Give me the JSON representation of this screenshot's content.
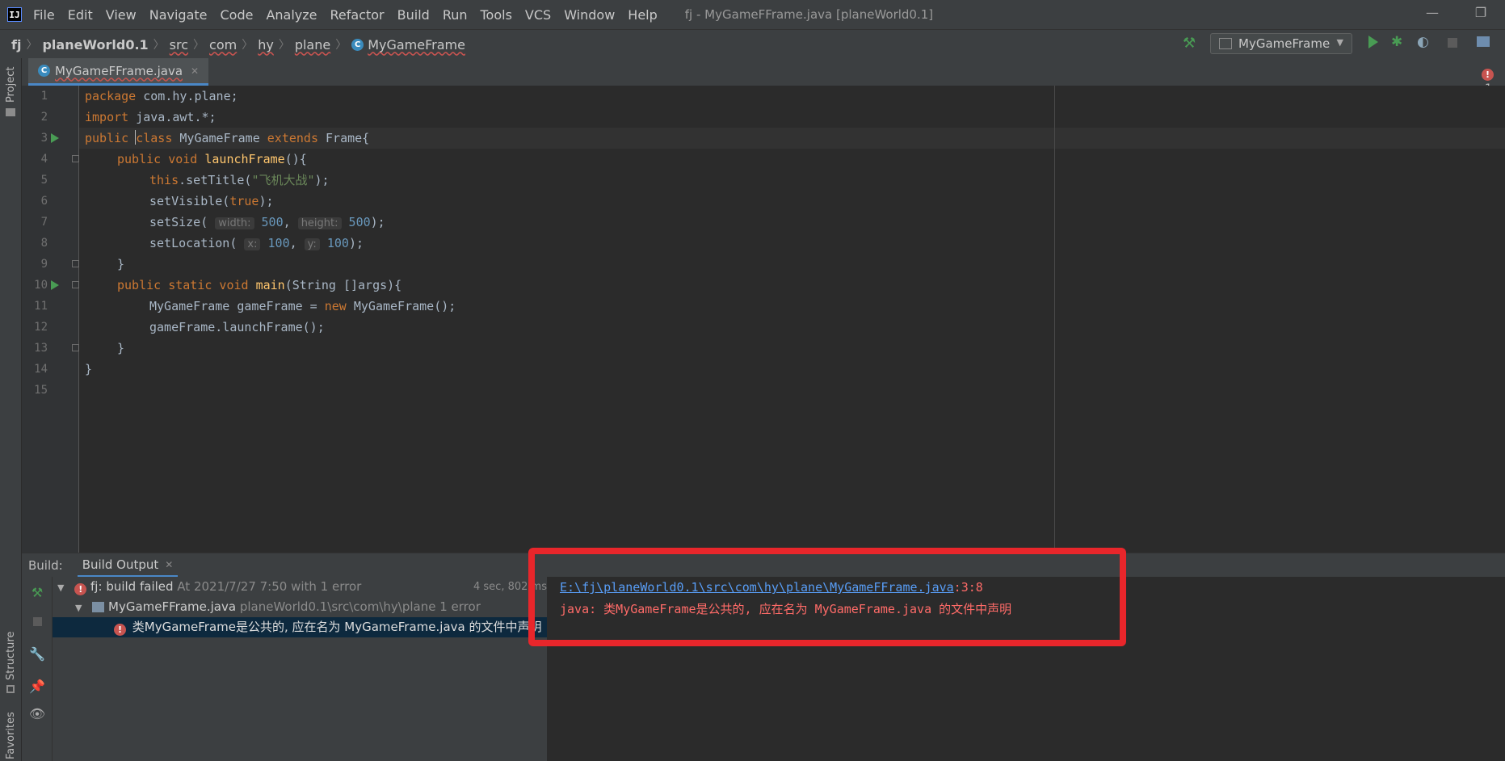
{
  "window": {
    "app_icon": "IJ",
    "title": "fj - MyGameFFrame.java [planeWorld0.1]",
    "minimize": "—",
    "restore": "❐"
  },
  "menu": [
    "File",
    "Edit",
    "View",
    "Navigate",
    "Code",
    "Analyze",
    "Refactor",
    "Build",
    "Run",
    "Tools",
    "VCS",
    "Window",
    "Help"
  ],
  "breadcrumb": [
    "fj",
    "planeWorld0.1",
    "src",
    "com",
    "hy",
    "plane",
    "MyGameFrame"
  ],
  "run_config": {
    "label": "MyGameFrame"
  },
  "left_strip": {
    "project": "Project",
    "structure": "Structure",
    "favorites": "Favorites"
  },
  "editor_tab": {
    "label": "MyGameFFrame.java",
    "close": "✕"
  },
  "error_stripe": {
    "count": "1"
  },
  "code_lines": [
    "1",
    "2",
    "3",
    "4",
    "5",
    "6",
    "7",
    "8",
    "9",
    "10",
    "11",
    "12",
    "13",
    "14",
    "15"
  ],
  "code": {
    "l1": [
      "package",
      " com.hy.plane;"
    ],
    "l2": [
      "import",
      " java.awt.*;"
    ],
    "l3": [
      "public",
      " ",
      "class",
      " MyGameFrame ",
      "extends",
      " Frame{"
    ],
    "l4": [
      "public void ",
      "launchFrame",
      "(){"
    ],
    "l5": [
      "this",
      ".setTitle(",
      "\"飞机大战\"",
      ");"
    ],
    "l6": [
      "setVisible(",
      "true",
      ");"
    ],
    "l7": [
      "setSize( ",
      "width:",
      " 500",
      ", ",
      "height:",
      " 500",
      ");"
    ],
    "l8": [
      "setLocation( ",
      "x:",
      " 100",
      ", ",
      "y:",
      " 100",
      ");"
    ],
    "l9": "}",
    "l10": [
      "public static void ",
      "main",
      "(String []args){"
    ],
    "l11": [
      "MyGameFrame gameFrame = ",
      "new",
      " MyGameFrame();"
    ],
    "l12": "gameFrame.launchFrame();",
    "l13": "}",
    "l14": "}"
  },
  "build": {
    "label": "Build:",
    "tab": "Build Output",
    "tab_close": "✕",
    "tree": {
      "root_name": "fj:",
      "root_status": " build failed",
      "root_time": " At 2021/7/27 7:50 with 1 error",
      "root_duration": "4 sec, 802 ms",
      "file_name": "MyGameFFrame.java",
      "file_path": " planeWorld0.1\\src\\com\\hy\\plane",
      "file_errors": " 1 error",
      "error_msg": "类MyGameFrame是公共的, 应在名为 MyGameFrame.java 的文件中声明"
    },
    "console": {
      "link": "E:\\fj\\planeWorld0.1\\src\\com\\hy\\plane\\MyGameFFrame.java",
      "position": ":3:8",
      "message": "java: 类MyGameFrame是公共的, 应在名为 MyGameFrame.java 的文件中声明"
    }
  },
  "colors": {
    "accent": "#4a88c7",
    "error": "#c75450",
    "highlight_box": "#e8262b"
  }
}
